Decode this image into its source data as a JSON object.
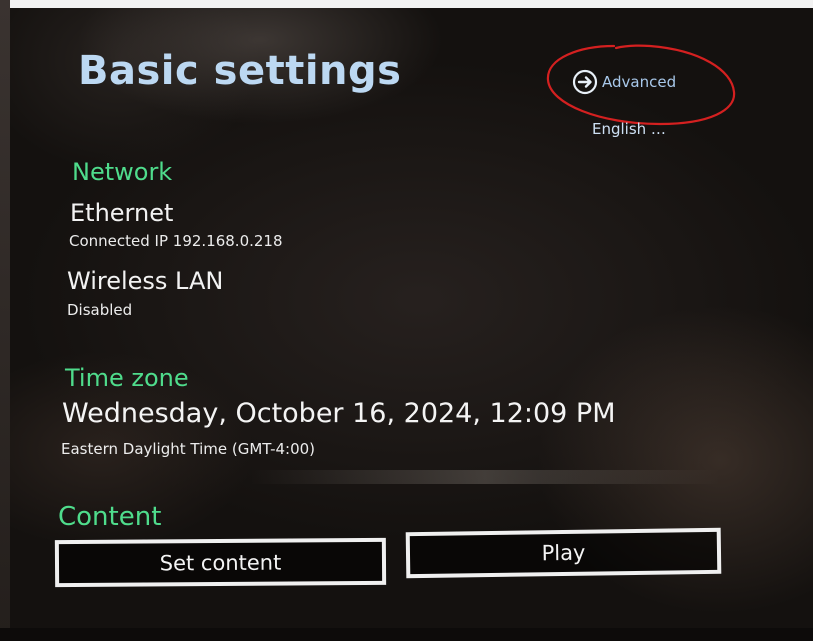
{
  "header": {
    "title": "Basic settings",
    "advanced_label": "Advanced",
    "advanced_icon": "arrow-right-circle-icon",
    "language": "English …"
  },
  "network": {
    "section_label": "Network",
    "ethernet": {
      "label": "Ethernet",
      "status": "Connected IP 192.168.0.218"
    },
    "wireless": {
      "label": "Wireless LAN",
      "status": "Disabled"
    }
  },
  "time_zone": {
    "section_label": "Time zone",
    "datetime": "Wednesday, October 16, 2024, 12:09 PM",
    "zone": "Eastern Daylight Time (GMT-4:00)"
  },
  "content": {
    "section_label": "Content",
    "set_content_label": "Set content",
    "play_label": "Play"
  },
  "colors": {
    "title": "#bcd8f2",
    "section_heading": "#4fdc8c",
    "annotation": "#d42020"
  }
}
